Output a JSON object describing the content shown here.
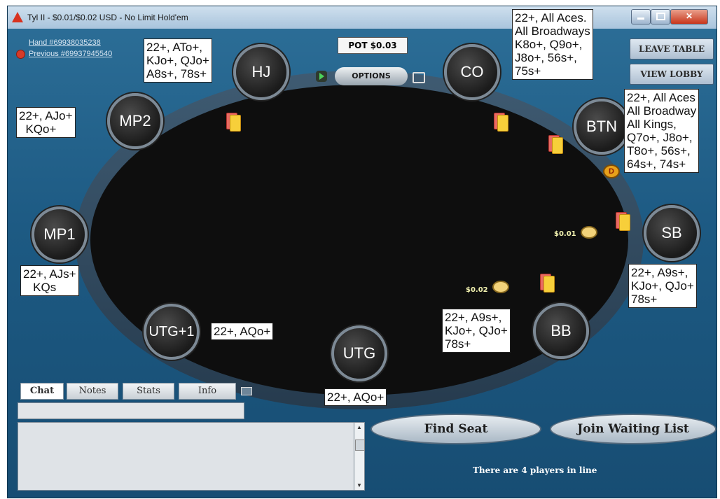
{
  "window": {
    "title": "Tyl II - $0.01/$0.02 USD - No Limit Hold'em",
    "hand_label": "Hand    #69938035238",
    "previous_label": "Previous #69937945540"
  },
  "table": {
    "pot": "POT $0.03",
    "options": "OPTIONS",
    "leave_table": "LEAVE TABLE",
    "view_lobby": "VIEW LOBBY",
    "dealer_glyph": "D"
  },
  "seats": {
    "hj": "HJ",
    "co": "CO",
    "mp2": "MP2",
    "btn": "BTN",
    "mp1": "MP1",
    "sb": "SB",
    "utg1": "UTG+1",
    "utg": "UTG",
    "bb": "BB"
  },
  "ranges": {
    "hj": "22+, ATo+,\nKJo+, QJo+\nA8s+, 78s+",
    "co": "22+, All Aces.\nAll Broadways\nK8o+, Q9o+,\nJ8o+, 56s+,\n75s+",
    "mp2": "22+, AJo+\n  KQo+",
    "btn": "22+, All Aces\nAll Broadway\nAll Kings,\nQ7o+, J8o+,\nT8o+, 56s+,\n64s+, 74s+",
    "mp1": "22+, AJs+\n   KQs",
    "sb": "22+, A9s+,\nKJo+, QJo+\n78s+",
    "utg1": "22+, AQo+",
    "bb": "22+, A9s+,\nKJo+, QJo+\n78s+",
    "utg": "22+, AQo+"
  },
  "bets": {
    "sb": "$0.01",
    "bb": "$0.02"
  },
  "chat": {
    "tabs": [
      "Chat",
      "Notes",
      "Stats",
      "Info"
    ],
    "input_value": "",
    "log": ""
  },
  "actions": {
    "find_seat": "Find Seat",
    "join_waiting_list": "Join Waiting List",
    "waiting_line": "There are 4 players in line"
  },
  "colors": {
    "background_blue": "#1d5a83",
    "felt": "#0e0e0e",
    "card_back": "#e86a62",
    "card_face": "#f7cf3a"
  },
  "icons": [
    "app-icon",
    "minimize-icon",
    "maximize-icon",
    "close-icon",
    "previous-hand-icon",
    "play-icon",
    "window-icon",
    "dealer-button-icon",
    "chip-icon",
    "popout-icon",
    "scroll-up-icon",
    "scroll-down-icon"
  ]
}
